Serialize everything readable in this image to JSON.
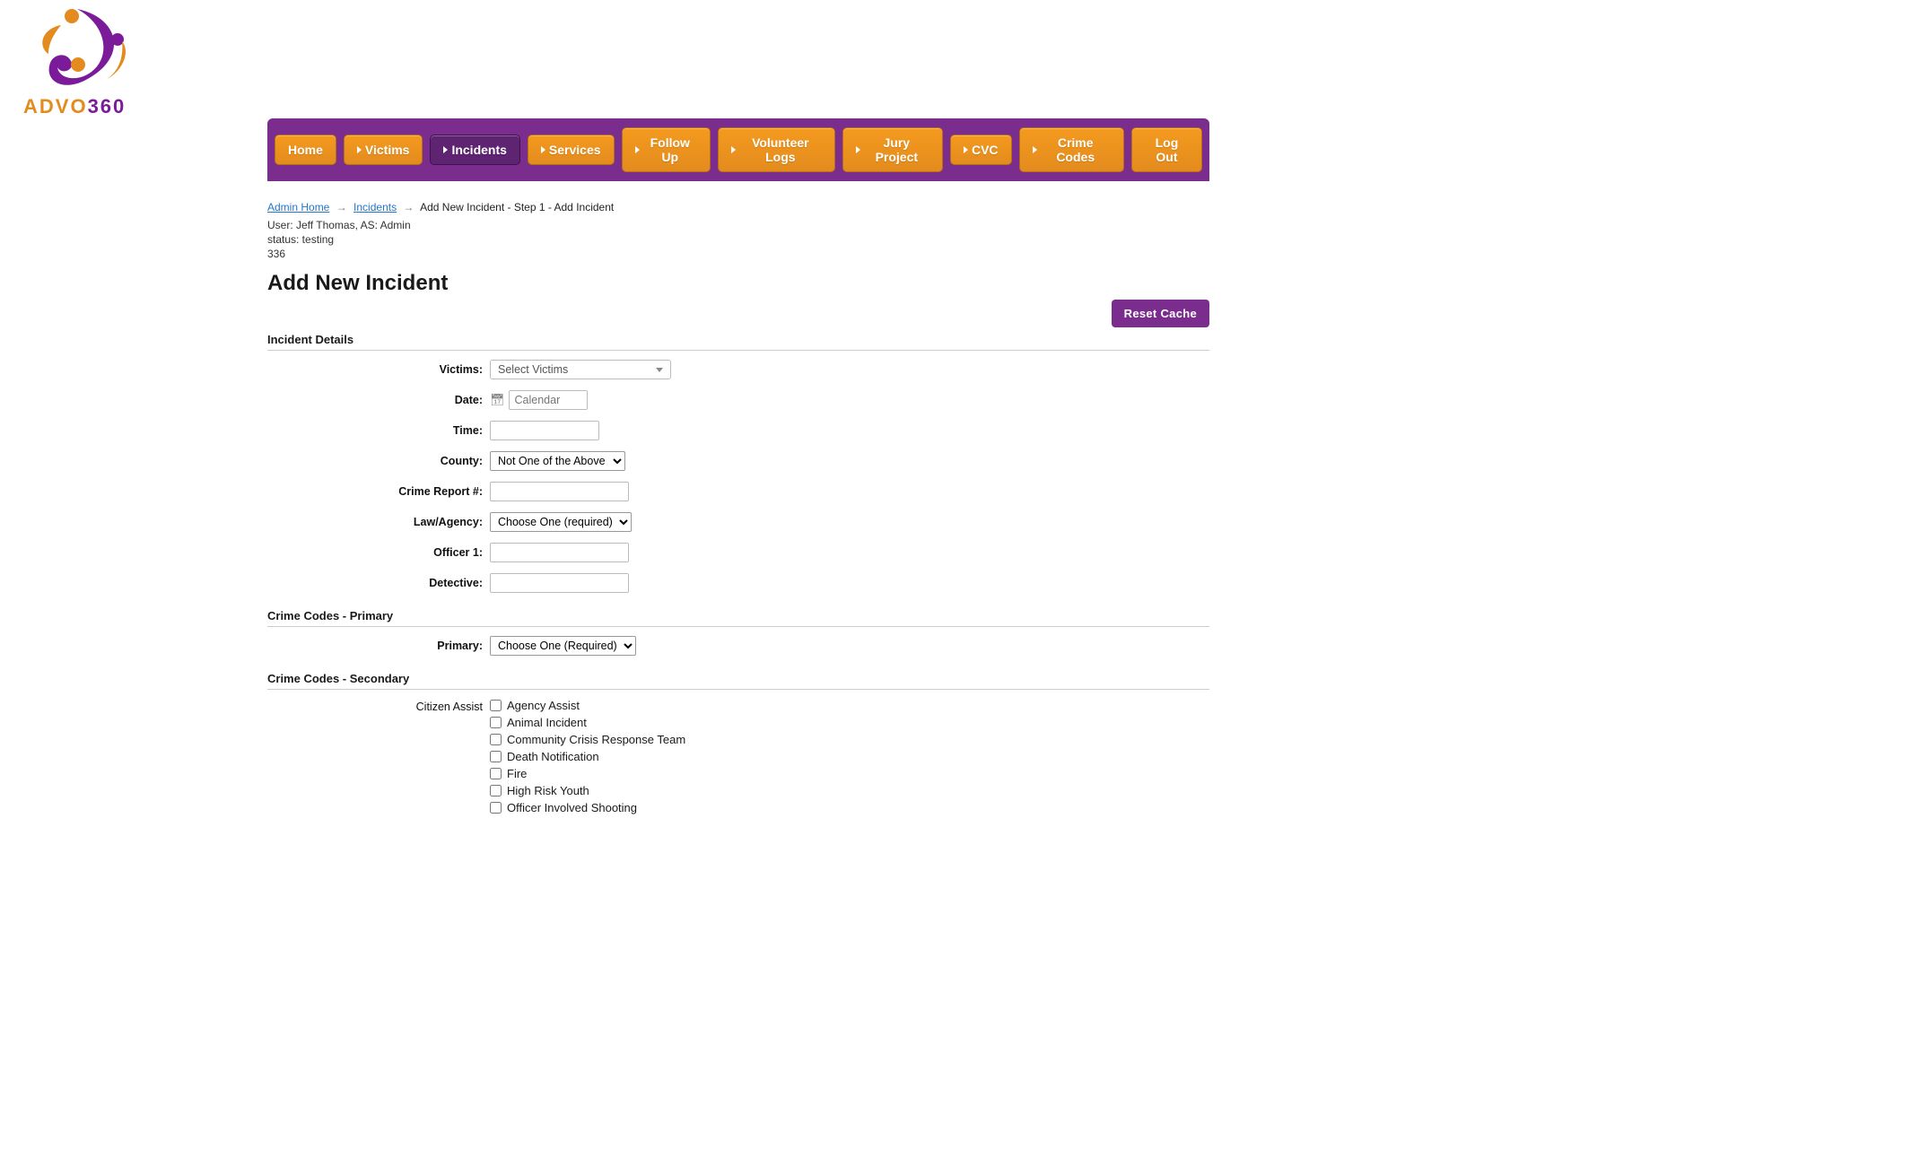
{
  "brand": {
    "advo": "ADVO",
    "n360": "360"
  },
  "nav": {
    "items": [
      {
        "label": "Home",
        "caret": false,
        "active": false
      },
      {
        "label": "Victims",
        "caret": true,
        "active": false
      },
      {
        "label": "Incidents",
        "caret": true,
        "active": true
      },
      {
        "label": "Services",
        "caret": true,
        "active": false
      },
      {
        "label": "Follow Up",
        "caret": true,
        "active": false
      },
      {
        "label": "Volunteer Logs",
        "caret": true,
        "active": false
      },
      {
        "label": "Jury Project",
        "caret": true,
        "active": false
      },
      {
        "label": "CVC",
        "caret": true,
        "active": false
      },
      {
        "label": "Crime Codes",
        "caret": true,
        "active": false
      },
      {
        "label": "Log Out",
        "caret": false,
        "active": false
      }
    ]
  },
  "breadcrumb": {
    "home": "Admin Home",
    "incidents": "Incidents",
    "tail": "Add New Incident - Step 1 - Add Incident"
  },
  "meta": {
    "user_line": "User: Jeff Thomas, AS: Admin",
    "status_line": "status: testing",
    "count": "336"
  },
  "page_title": "Add New Incident",
  "reset_cache_label": "Reset Cache",
  "sections": {
    "details": "Incident Details",
    "primary": "Crime Codes - Primary",
    "secondary": "Crime Codes - Secondary"
  },
  "fields": {
    "victims": {
      "label": "Victims:",
      "placeholder": "Select Victims"
    },
    "date": {
      "label": "Date:",
      "placeholder": "Calendar"
    },
    "time": {
      "label": "Time:"
    },
    "county": {
      "label": "County:",
      "selected": "Not One of the Above"
    },
    "crime_report": {
      "label": "Crime Report #:"
    },
    "law_agency": {
      "label": "Law/Agency:",
      "selected": "Choose One (required)"
    },
    "officer1": {
      "label": "Officer 1:"
    },
    "detective": {
      "label": "Detective:"
    },
    "primary": {
      "label": "Primary:",
      "selected": "Choose One (Required)"
    },
    "citizen_assist": {
      "label": "Citizen Assist",
      "options": [
        "Agency Assist",
        "Animal Incident",
        "Community Crisis Response Team",
        "Death Notification",
        "Fire",
        "High Risk Youth",
        "Officer Involved Shooting"
      ]
    }
  }
}
